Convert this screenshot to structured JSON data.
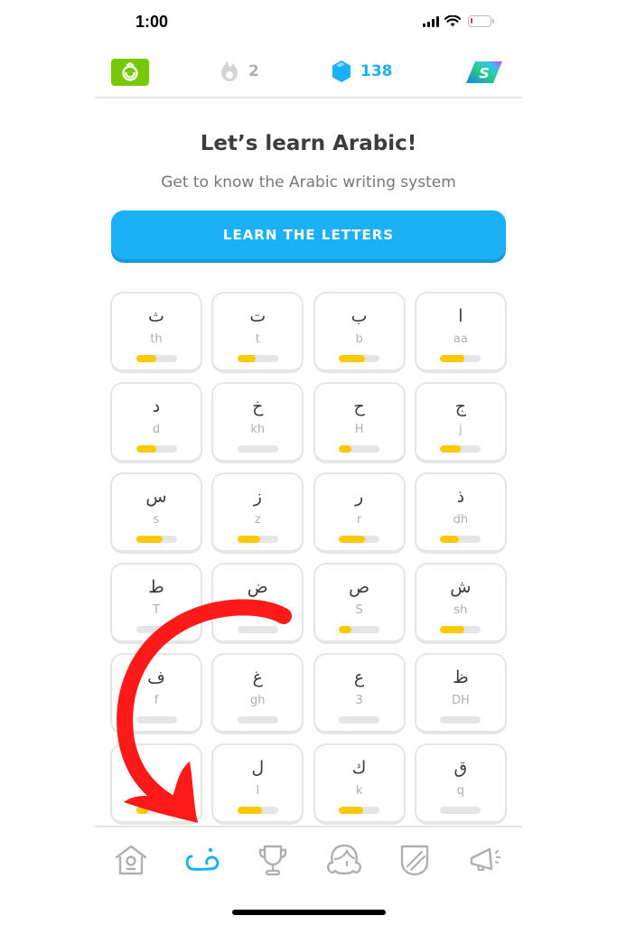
{
  "status_bar": {
    "time": "1:00"
  },
  "top_bar": {
    "course_icon": "arabic-course-flag-icon",
    "streak": {
      "icon": "flame-icon",
      "count": "2"
    },
    "gems": {
      "icon": "gem-icon",
      "count": "138"
    },
    "super_icon": "super-duolingo-icon"
  },
  "header": {
    "title": "Let’s learn Arabic!",
    "subtitle": "Get to know the Arabic writing system",
    "button_label": "LEARN THE LETTERS"
  },
  "colors": {
    "accent_blue": "#1cb0f6",
    "progress_yellow": "#ffc800",
    "course_green": "#78c800",
    "annotation_red": "#ff1a1a"
  },
  "letters": [
    {
      "letter": "ث",
      "translit": "th",
      "progress": 0.5
    },
    {
      "letter": "ت",
      "translit": "t",
      "progress": 0.45
    },
    {
      "letter": "ب",
      "translit": "b",
      "progress": 0.65
    },
    {
      "letter": "ا",
      "translit": "aa",
      "progress": 0.6
    },
    {
      "letter": "د",
      "translit": "d",
      "progress": 0.5
    },
    {
      "letter": "خ",
      "translit": "kh",
      "progress": 0
    },
    {
      "letter": "ح",
      "translit": "H",
      "progress": 0.3
    },
    {
      "letter": "ج",
      "translit": "j",
      "progress": 0.5
    },
    {
      "letter": "س",
      "translit": "s",
      "progress": 0.65
    },
    {
      "letter": "ز",
      "translit": "z",
      "progress": 0.55
    },
    {
      "letter": "ر",
      "translit": "r",
      "progress": 0.65
    },
    {
      "letter": "ذ",
      "translit": "dh",
      "progress": 0.45
    },
    {
      "letter": "ط",
      "translit": "T",
      "progress": 0
    },
    {
      "letter": "ض",
      "translit": "D",
      "progress": 0
    },
    {
      "letter": "ص",
      "translit": "S",
      "progress": 0.3
    },
    {
      "letter": "ش",
      "translit": "sh",
      "progress": 0.6
    },
    {
      "letter": "ف",
      "translit": "f",
      "progress": 0
    },
    {
      "letter": "غ",
      "translit": "gh",
      "progress": 0
    },
    {
      "letter": "ع",
      "translit": "3",
      "progress": 0
    },
    {
      "letter": "ظ",
      "translit": "DH",
      "progress": 0
    },
    {
      "letter": "",
      "translit": "",
      "progress": 0.3
    },
    {
      "letter": "ل",
      "translit": "l",
      "progress": 0.6
    },
    {
      "letter": "ك",
      "translit": "k",
      "progress": 0.6
    },
    {
      "letter": "ق",
      "translit": "q",
      "progress": 0
    }
  ],
  "bottom_nav": [
    {
      "name": "home",
      "icon": "birdhouse-icon",
      "active": false
    },
    {
      "name": "letters",
      "icon": "arabic-letter-icon",
      "active": true,
      "glyph": "ض"
    },
    {
      "name": "leaderboard",
      "icon": "trophy-icon",
      "active": false
    },
    {
      "name": "profile",
      "icon": "profile-avatar-icon",
      "active": false
    },
    {
      "name": "shop",
      "icon": "shield-icon",
      "active": false
    },
    {
      "name": "news",
      "icon": "megaphone-icon",
      "active": false
    }
  ],
  "annotation": {
    "type": "curved-arrow",
    "color": "#ff1a1a",
    "points_to": "letters tab"
  }
}
